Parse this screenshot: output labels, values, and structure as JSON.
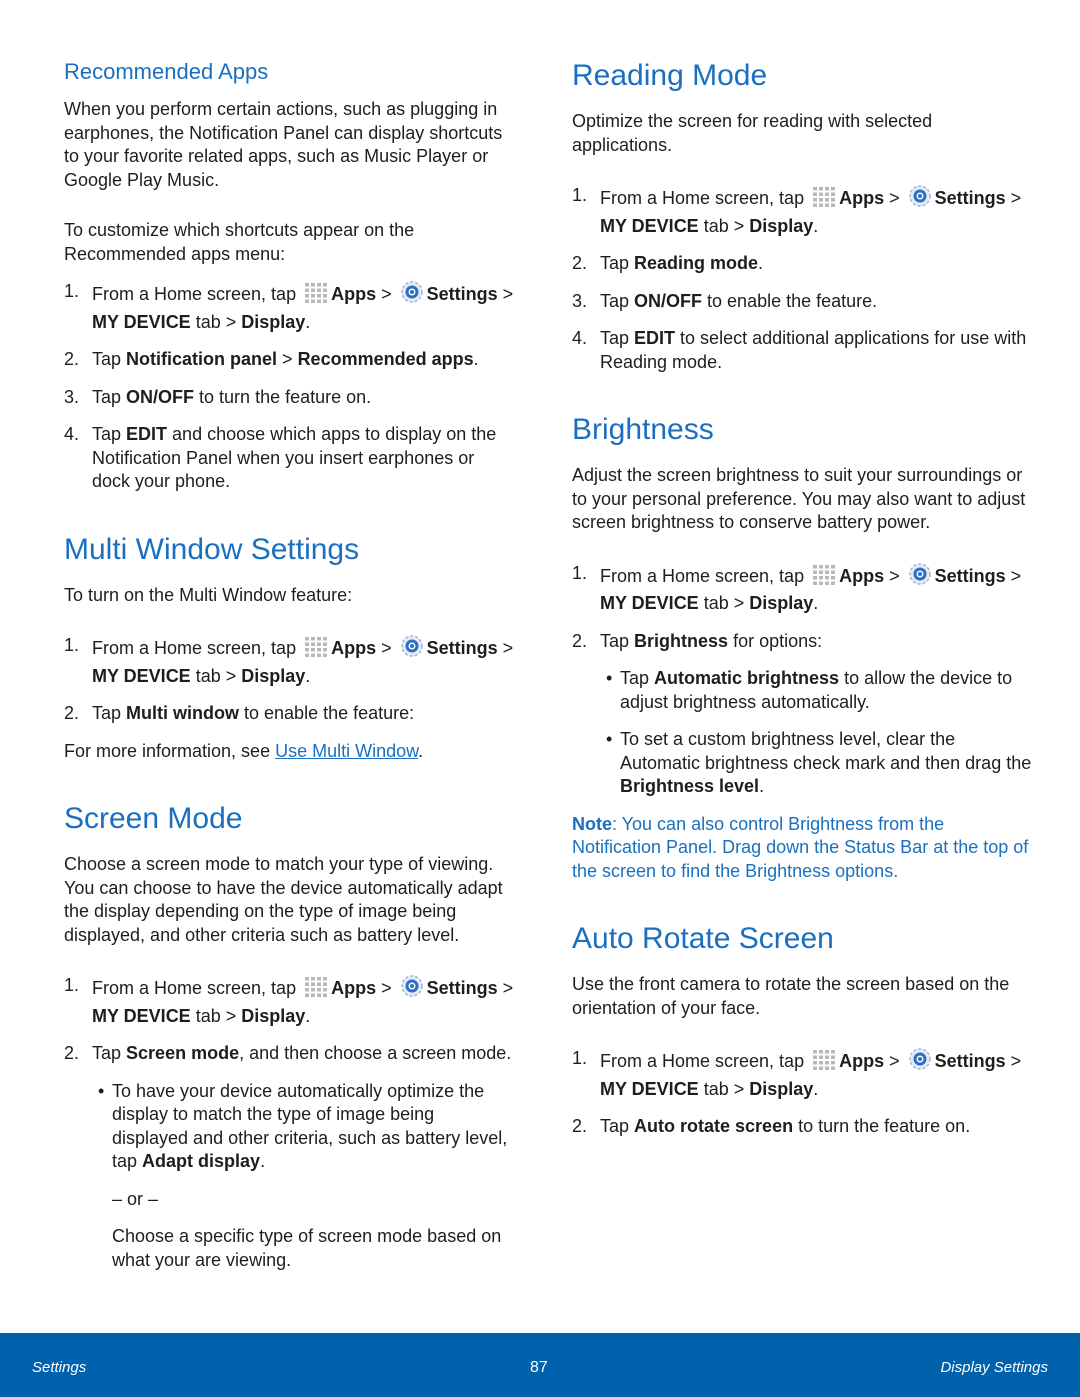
{
  "colors": {
    "heading": "#1a6fc0",
    "footer": "#0061ad"
  },
  "left": [
    {
      "type": "h2",
      "parts": [
        "Recommended Apps"
      ]
    },
    {
      "type": "p",
      "gap": true,
      "parts": [
        "When you perform certain actions, such as plugging in earphones, the Notification Panel can display shortcuts to your favorite related apps, such as Music Player or Google Play Music."
      ]
    },
    {
      "type": "p",
      "parts": [
        "To customize which shortcuts appear on the Recommended apps menu:"
      ]
    },
    {
      "type": "step",
      "n": "1.",
      "parts": [
        "From a Home screen, tap ",
        {
          "icon": "apps-grid-icon"
        },
        {
          "b": "Apps"
        },
        " > ",
        {
          "icon": "settings-gear-icon"
        },
        {
          "b": "Settings"
        },
        " > ",
        {
          "b": "MY DEVICE"
        },
        " tab > ",
        {
          "b": "Display"
        },
        "."
      ]
    },
    {
      "type": "step",
      "n": "2.",
      "parts": [
        "Tap ",
        {
          "b": "Notification panel"
        },
        " > ",
        {
          "b": "Recommended apps"
        },
        "."
      ]
    },
    {
      "type": "step",
      "n": "3.",
      "parts": [
        "Tap ",
        {
          "b": "ON/OFF"
        },
        " to turn the feature on."
      ]
    },
    {
      "type": "step",
      "n": "4.",
      "parts": [
        "Tap ",
        {
          "b": "EDIT"
        },
        " and choose which apps to display on the Notification Panel when you insert earphones or dock your phone."
      ]
    },
    {
      "type": "h1",
      "parts": [
        "Multi Window Settings"
      ]
    },
    {
      "type": "p",
      "gap": true,
      "parts": [
        "To turn on the Multi Window feature:"
      ]
    },
    {
      "type": "step",
      "n": "1.",
      "parts": [
        "From a Home screen, tap ",
        {
          "icon": "apps-grid-icon"
        },
        {
          "b": "Apps"
        },
        " > ",
        {
          "icon": "settings-gear-icon"
        },
        {
          "b": "Settings"
        },
        " > ",
        {
          "b": "MY DEVICE"
        },
        " tab > ",
        {
          "b": "Display"
        },
        "."
      ]
    },
    {
      "type": "step",
      "n": "2.",
      "parts": [
        "Tap ",
        {
          "b": "Multi window"
        },
        " to enable the feature:"
      ]
    },
    {
      "type": "p",
      "parts": [
        "For more information, see ",
        {
          "link": "Use Multi Window"
        },
        "."
      ]
    },
    {
      "type": "h1",
      "parts": [
        "Screen Mode"
      ]
    },
    {
      "type": "p",
      "gap": true,
      "parts": [
        "Choose a screen mode to match your type of viewing. You can choose to have the device automatically adapt the display depending on the type of image being displayed, and other criteria such as battery level."
      ]
    },
    {
      "type": "step",
      "n": "1.",
      "parts": [
        "From a Home screen, tap ",
        {
          "icon": "apps-grid-icon"
        },
        {
          "b": "Apps"
        },
        " > ",
        {
          "icon": "settings-gear-icon"
        },
        {
          "b": "Settings"
        },
        " > ",
        {
          "b": "MY DEVICE"
        },
        " tab > ",
        {
          "b": "Display"
        },
        "."
      ]
    },
    {
      "type": "step",
      "n": "2.",
      "parts": [
        "Tap ",
        {
          "b": "Screen mode"
        },
        ", and then choose a screen mode."
      ]
    },
    {
      "type": "bullet",
      "parts": [
        "To have your device automatically optimize the display to match the type of image being displayed and other criteria, such as battery level, tap ",
        {
          "b": "Adapt display"
        },
        "."
      ]
    },
    {
      "type": "indent",
      "parts": [
        "– or –"
      ]
    },
    {
      "type": "indent",
      "parts": [
        "Choose a specific type of screen mode based on what your are viewing."
      ]
    }
  ],
  "right": [
    {
      "type": "h1",
      "first": true,
      "parts": [
        "Reading Mode"
      ]
    },
    {
      "type": "p",
      "gap": true,
      "parts": [
        "Optimize the screen for reading with selected applications."
      ]
    },
    {
      "type": "step",
      "n": "1.",
      "parts": [
        "From a Home screen, tap ",
        {
          "icon": "apps-grid-icon"
        },
        {
          "b": "Apps"
        },
        " > ",
        {
          "icon": "settings-gear-icon"
        },
        {
          "b": "Settings"
        },
        " > ",
        {
          "b": "MY DEVICE"
        },
        " tab > ",
        {
          "b": "Display"
        },
        "."
      ]
    },
    {
      "type": "step",
      "n": "2.",
      "parts": [
        "Tap ",
        {
          "b": "Reading mode"
        },
        "."
      ]
    },
    {
      "type": "step",
      "n": "3.",
      "parts": [
        "Tap ",
        {
          "b": "ON/OFF"
        },
        " to enable the feature."
      ]
    },
    {
      "type": "step",
      "n": "4.",
      "parts": [
        "Tap ",
        {
          "b": "EDIT"
        },
        " to select additional applications for use with Reading mode."
      ]
    },
    {
      "type": "h1",
      "parts": [
        "Brightness"
      ]
    },
    {
      "type": "p",
      "gap": true,
      "parts": [
        "Adjust the screen brightness to suit your surroundings or to your personal preference. You may also want to adjust screen brightness to conserve battery power."
      ]
    },
    {
      "type": "step",
      "n": "1.",
      "parts": [
        "From a Home screen, tap ",
        {
          "icon": "apps-grid-icon"
        },
        {
          "b": "Apps"
        },
        " > ",
        {
          "icon": "settings-gear-icon"
        },
        {
          "b": "Settings"
        },
        " > ",
        {
          "b": "MY DEVICE"
        },
        " tab > ",
        {
          "b": "Display"
        },
        "."
      ]
    },
    {
      "type": "step",
      "n": "2.",
      "parts": [
        "Tap ",
        {
          "b": "Brightness"
        },
        " for options:"
      ]
    },
    {
      "type": "bullet",
      "parts": [
        "Tap ",
        {
          "b": "Automatic brightness"
        },
        " to allow the device to adjust brightness automatically."
      ]
    },
    {
      "type": "bullet",
      "parts": [
        "To set a custom brightness level, clear the Automatic brightness check mark and then drag the ",
        {
          "b": "Brightness level"
        },
        "."
      ]
    },
    {
      "type": "note",
      "parts": [
        {
          "b": "Note"
        },
        ": You can also control Brightness from the Notification Panel. Drag down the Status Bar at the top of the screen to find the Brightness options."
      ]
    },
    {
      "type": "h1",
      "parts": [
        "Auto Rotate Screen"
      ]
    },
    {
      "type": "p",
      "gap": true,
      "parts": [
        "Use the front camera to rotate the screen based on the orientation of your face."
      ]
    },
    {
      "type": "step",
      "n": "1.",
      "parts": [
        "From a Home screen, tap ",
        {
          "icon": "apps-grid-icon"
        },
        {
          "b": "Apps"
        },
        " > ",
        {
          "icon": "settings-gear-icon"
        },
        {
          "b": "Settings"
        },
        " > ",
        {
          "b": "MY DEVICE"
        },
        " tab > ",
        {
          "b": "Display"
        },
        "."
      ]
    },
    {
      "type": "step",
      "n": "2.",
      "parts": [
        "Tap ",
        {
          "b": "Auto rotate screen"
        },
        " to turn the feature on."
      ]
    }
  ],
  "footer": {
    "left": "Settings",
    "page": "87",
    "right": "Display Settings"
  }
}
